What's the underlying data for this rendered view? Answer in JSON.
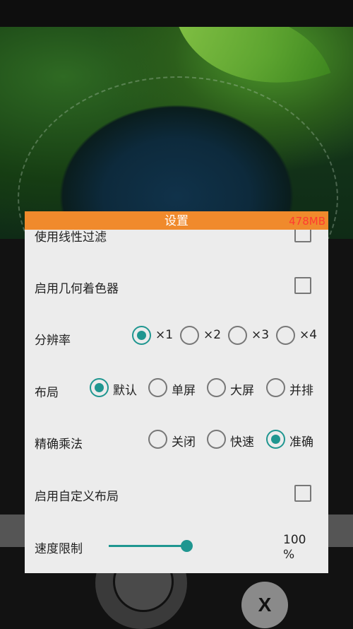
{
  "dialog": {
    "title": "设置",
    "memory": "478MB"
  },
  "settings": {
    "linear_filter": {
      "label": "使用线性过滤",
      "checked": false
    },
    "geometry_shader": {
      "label": "启用几何着色器",
      "checked": false
    },
    "resolution": {
      "label": "分辨率",
      "options": [
        "×1",
        "×2",
        "×3",
        "×4"
      ],
      "selected": "×1"
    },
    "layout": {
      "label": "布局",
      "options": [
        "默认",
        "单屏",
        "大屏",
        "并排"
      ],
      "selected": "默认"
    },
    "precise_multiply": {
      "label": "精确乘法",
      "options": [
        "关闭",
        "快速",
        "准确"
      ],
      "selected": "准确"
    },
    "custom_layout": {
      "label": "启用自定义布局",
      "checked": false
    },
    "speed_limit": {
      "label": "速度限制",
      "value_line1": "100",
      "value_line2": "%",
      "level": 1.0
    }
  },
  "controls": {
    "x_button": "X"
  },
  "colors": {
    "header": "#f08a2c",
    "accent": "#1f9690",
    "memory_text": "#ff3b30"
  }
}
